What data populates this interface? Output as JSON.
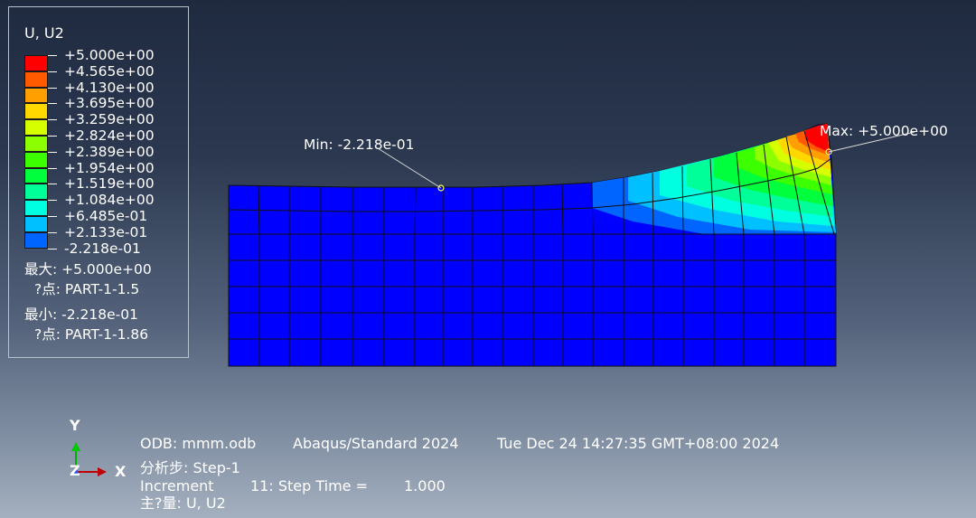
{
  "legend": {
    "title": "U, U2",
    "levels": [
      {
        "label": "+5.000e+00",
        "color": "#ff0000"
      },
      {
        "label": "+4.565e+00",
        "color": "#ff5a00"
      },
      {
        "label": "+4.130e+00",
        "color": "#ffa000"
      },
      {
        "label": "+3.695e+00",
        "color": "#ffd800"
      },
      {
        "label": "+3.259e+00",
        "color": "#d6ff00"
      },
      {
        "label": "+2.824e+00",
        "color": "#8cff00"
      },
      {
        "label": "+2.389e+00",
        "color": "#3cff00"
      },
      {
        "label": "+1.954e+00",
        "color": "#00ff3c"
      },
      {
        "label": "+1.519e+00",
        "color": "#00ff98"
      },
      {
        "label": "+1.084e+00",
        "color": "#00ffe0"
      },
      {
        "label": "+6.485e-01",
        "color": "#00c0ff"
      },
      {
        "label": "+2.133e-01",
        "color": "#0064ff"
      },
      {
        "label": "-2.218e-01",
        "color": "#0000ff"
      }
    ],
    "max_label": "最大: +5.000e+00",
    "max_node": "?点: PART-1-1.5",
    "min_label": "最小: -2.218e-01",
    "min_node": "?点: PART-1-1.86"
  },
  "probes": {
    "min": "Min: -2.218e-01",
    "max": "Max: +5.000e+00"
  },
  "info": {
    "line1_odb": "ODB: mmm.odb",
    "line1_solver": "Abaqus/Standard 2024",
    "line1_date": "Tue Dec 24 14:27:35 GMT+08:00 2024",
    "line2": "分析步: Step-1",
    "line3_label": "Increment",
    "line3_value": "11: Step Time =",
    "line3_time": "1.000",
    "line4": "主?量: U, U2"
  },
  "triad": {
    "y": "Y",
    "z": "Z",
    "x": "X"
  },
  "colors": {
    "mesh_base": "#0000ff",
    "edge": "#101010",
    "highlight": "#ff0000"
  }
}
